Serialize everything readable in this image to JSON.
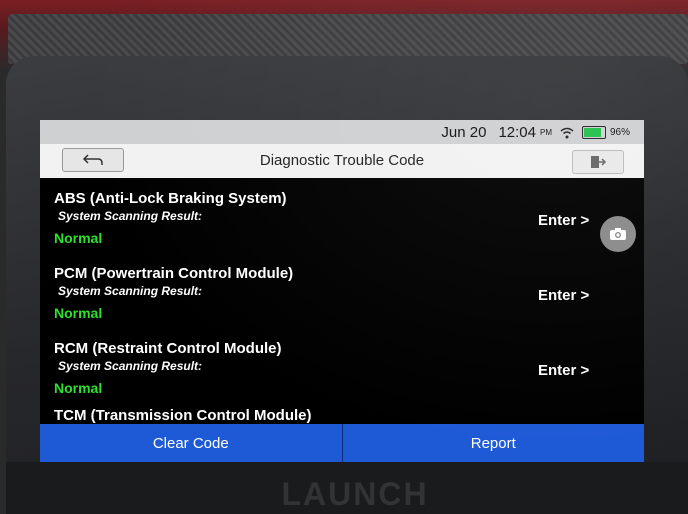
{
  "device": {
    "brand": "LAUNCH"
  },
  "status_bar": {
    "date": "Jun 20",
    "time": "12:04",
    "ampm": "PM",
    "battery_pct": "96%",
    "battery_level": 0.96,
    "icons": [
      "wifi-icon",
      "battery-icon"
    ]
  },
  "header": {
    "title": "Diagnostic Trouble Code",
    "icons": [
      "back-icon",
      "exit-icon"
    ]
  },
  "modules": [
    {
      "name": "ABS (Anti-Lock Braking System)",
      "result_label": "System Scanning Result:",
      "status": "Normal",
      "action": "Enter >"
    },
    {
      "name": "PCM (Powertrain Control Module)",
      "result_label": "System Scanning Result:",
      "status": "Normal",
      "action": "Enter >"
    },
    {
      "name": "RCM (Restraint Control Module)",
      "result_label": "System Scanning Result:",
      "status": "Normal",
      "action": "Enter >"
    },
    {
      "name": "TCM (Transmission Control Module)"
    }
  ],
  "actions": {
    "clear": "Clear Code",
    "report": "Report"
  },
  "colors": {
    "accent": "#1f5ad6",
    "status_normal": "#2ee02e",
    "title_bar": "#f2f2f2"
  }
}
